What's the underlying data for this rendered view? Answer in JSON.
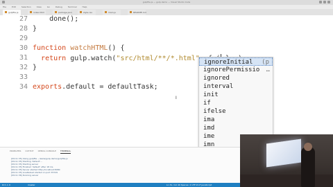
{
  "titlebar": {
    "title": "gulpfile.js — gulp-demo — Visual Studio Code"
  },
  "menu": [
    "File",
    "Edit",
    "Selection",
    "View",
    "Go",
    "Debug",
    "Terminal",
    "Help"
  ],
  "tabs": [
    {
      "label": "gulpfile.js"
    },
    {
      "label": "index.html"
    },
    {
      "label": "package.json"
    },
    {
      "label": "style.css"
    },
    {
      "label": "main.js"
    },
    {
      "label": "README.md"
    }
  ],
  "editor": {
    "lines": [
      {
        "num": "27",
        "text": "    done();"
      },
      {
        "num": "28",
        "text": "}"
      },
      {
        "num": "29",
        "text": ""
      },
      {
        "num": "30",
        "text": "function watchHTML() {"
      },
      {
        "num": "31",
        "text": "  return gulp.watch(\"src/html/**/*.html\", { i }, );"
      },
      {
        "num": "32",
        "text": "}"
      },
      {
        "num": "33",
        "text": ""
      },
      {
        "num": "34",
        "text": "exports.default = defaultTask;"
      }
    ],
    "line30": {
      "kw": "function",
      "fn": "watchHTML",
      "rest": "() {"
    },
    "line31": {
      "kw": "return",
      "pre": " gulp.watch(",
      "str": "\"src/html/**/*.html\"",
      "post_before_cursor": ", { i",
      "post_after_cursor": " }, );"
    },
    "line34": {
      "kw": "exports",
      "rest": ".default = defaultTask;"
    }
  },
  "suggestions": [
    {
      "label": "ignoreInitial",
      "hint": "(p"
    },
    {
      "label": "ignorePermissio",
      "hint": "…"
    },
    {
      "label": "ignored",
      "hint": ""
    },
    {
      "label": "interval",
      "hint": ""
    },
    {
      "label": "init",
      "hint": ""
    },
    {
      "label": "if",
      "hint": ""
    },
    {
      "label": "ifelse",
      "hint": ""
    },
    {
      "label": "ima",
      "hint": ""
    },
    {
      "label": "imd",
      "hint": ""
    },
    {
      "label": "ime",
      "hint": ""
    },
    {
      "label": "imn",
      "hint": ""
    },
    {
      "label": "imp",
      "hint": ""
    }
  ],
  "panel": {
    "tabs": [
      "PROBLEMS",
      "OUTPUT",
      "DEBUG CONSOLE",
      "TERMINAL"
    ],
    "log": [
      "[09:11:35] Using gulpfile ~/www/gulp-demo/gulpfile.js",
      "[09:11:35] Starting 'default'...",
      "[09:11:35] Starting server",
      "[09:11:35] Finished 'default' after 18 ms",
      "[09:11:35] Server started http://localhost:8080",
      "[09:11:35] LiveReload started on port 35729",
      "[09:11:36] Running server"
    ]
  },
  "statusbar": {
    "left": "⊗ 0 ⚠ 0",
    "branch": "master",
    "right": "Ln 31, Col 49   Spaces: 2   UTF-8   LF   JavaScript"
  }
}
